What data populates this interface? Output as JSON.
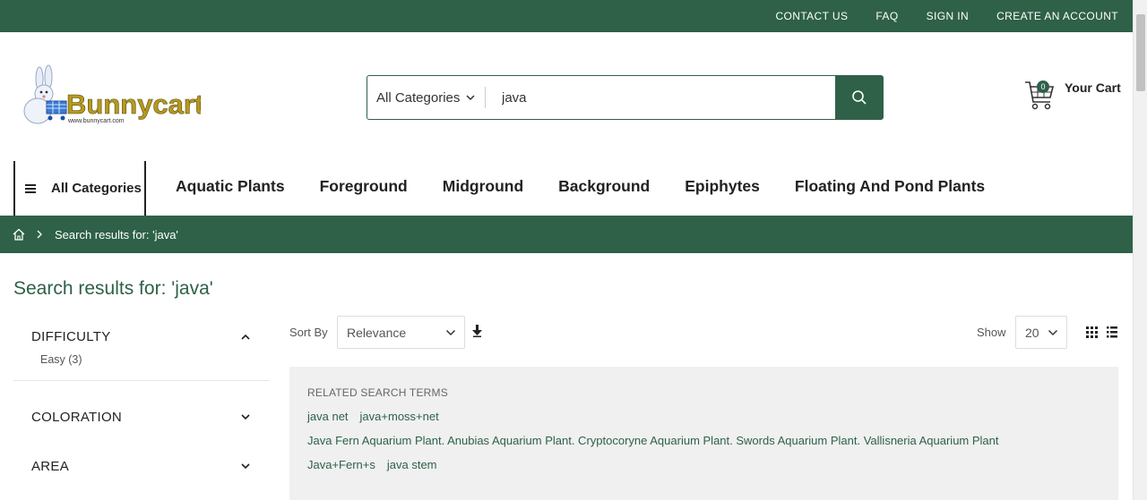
{
  "topbar": {
    "links": [
      "CONTACT US",
      "FAQ",
      "SIGN IN",
      "CREATE AN ACCOUNT"
    ]
  },
  "logo": {
    "text": "Bunnycart",
    "url_text": "www.bunnycart.com"
  },
  "search": {
    "category": "All Categories",
    "query": "java"
  },
  "cart": {
    "count": "0",
    "label": "Your Cart"
  },
  "nav": {
    "all_categories": "All Categories",
    "items": [
      "Aquatic Plants",
      "Foreground",
      "Midground",
      "Background",
      "Epiphytes",
      "Floating And Pond Plants"
    ]
  },
  "breadcrumb": {
    "current": "Search results for: 'java'"
  },
  "page_title": "Search results for: 'java'",
  "filters": [
    {
      "title": "DIFFICULTY",
      "expanded": true,
      "options": [
        "Easy (3)"
      ]
    },
    {
      "title": "COLORATION",
      "expanded": false
    },
    {
      "title": "AREA",
      "expanded": false
    }
  ],
  "toolbar": {
    "sort_label": "Sort By",
    "sort_value": "Relevance",
    "show_label": "Show",
    "limit_value": "20"
  },
  "related": {
    "title": "RELATED SEARCH TERMS",
    "rows": [
      [
        "java net",
        "java+moss+net"
      ],
      [
        "Java Fern Aquarium Plant. Anubias Aquarium Plant. Cryptocoryne Aquarium Plant. Swords Aquarium Plant. Vallisneria Aquarium Plant"
      ],
      [
        "Java+Fern+s",
        "java stem"
      ]
    ]
  },
  "colors": {
    "brand": "#2e6148",
    "related_bg": "#f0f0f0"
  }
}
